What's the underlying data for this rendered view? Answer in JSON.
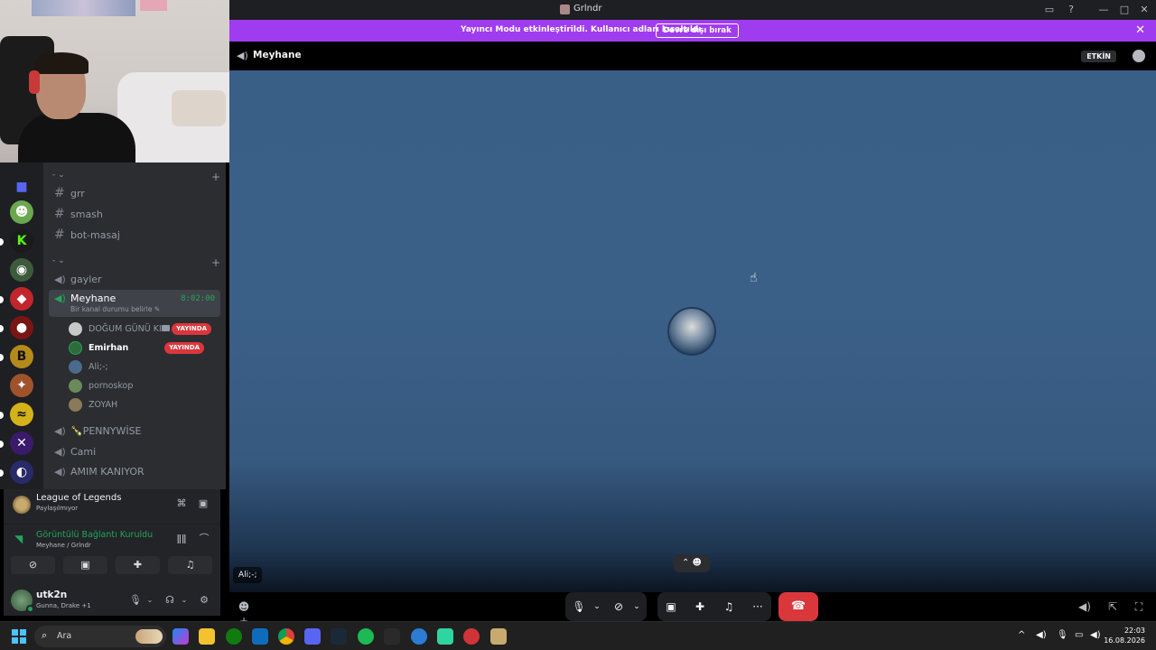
{
  "window": {
    "title": "Grlndr"
  },
  "streamer_mode": {
    "message": "Yayıncı Modu etkinleştirildi. Kullanıcı adları kısaltıldı.",
    "button": "Devre dışı bırak"
  },
  "header": {
    "channel_name": "Meyhane",
    "badge": "ETKİN"
  },
  "channels": {
    "category1": "- ⌄",
    "category2": "- ⌄",
    "text_channels": [
      "grr",
      "smash",
      "bot-masaj"
    ],
    "voice_channel_gayler": "gayler",
    "active_voice": {
      "name": "Meyhane",
      "timer": "8:02:00",
      "status": "Bir kanal durumu belirle ✎"
    },
    "voice_users": [
      {
        "name": "DOĞUM GÜNÜ KIZI",
        "live": "YAYINDA",
        "camera": true
      },
      {
        "name": "Emirhan",
        "live": "YAYINDA"
      },
      {
        "name": "Ali;-;"
      },
      {
        "name": "pornoskop"
      },
      {
        "name": "ZOYAH"
      }
    ],
    "other_voice": [
      "🍾PENNYWİSE",
      "Cami",
      "AMIM KANIYOR"
    ]
  },
  "activity": {
    "game": "League of Legends",
    "game_sub": "Paylaşılmıyor"
  },
  "rtc": {
    "title": "Görüntülü Bağlantı Kuruldu",
    "sub": "Meyhane / Grlndr"
  },
  "user": {
    "name": "utk2n",
    "sub": "Gunna, Drake +1"
  },
  "stage": {
    "tile_name": "Ali;-;"
  },
  "taskbar": {
    "search": "Ara",
    "time": "22:03",
    "date": "16.08.2026"
  },
  "colors": {
    "accent_purple": "#a03cf0",
    "voice_green": "#23a55a",
    "live_red": "#da373c",
    "stage_blue": "#3b6088"
  }
}
